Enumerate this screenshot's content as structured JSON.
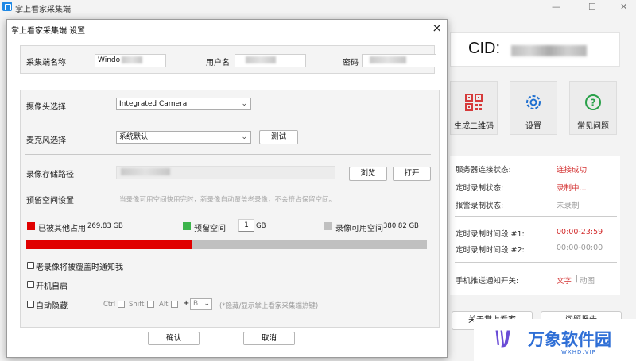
{
  "main": {
    "title": "掌上看家采集端",
    "cid_label": "CID:",
    "buttons": [
      {
        "label": "生成二维码",
        "icon": "qr-code-icon"
      },
      {
        "label": "设置",
        "icon": "gear-icon"
      },
      {
        "label": "常见问题",
        "icon": "question-icon"
      }
    ],
    "status": {
      "server_label": "服务器连接状态:",
      "server_value": "连接成功",
      "timer_rec_label": "定时录制状态:",
      "timer_rec_value": "录制中...",
      "alarm_rec_label": "报警录制状态:",
      "alarm_rec_value": "未录制",
      "interval1_label": "定时录制时间段 #1:",
      "interval1_value": "00:00-23:59",
      "interval2_label": "定时录制时间段 #2:",
      "interval2_value": "00:00-00:00",
      "push_label": "手机推送通知开关:",
      "push_text": "文字",
      "push_sep": "|",
      "push_anim": "动图"
    },
    "bottom_buttons": [
      "关于掌上看家",
      "问题报告"
    ]
  },
  "dialog": {
    "title": "掌上看家采集端 设置",
    "name_label": "采集端名称",
    "name_value": "Windo",
    "user_label": "用户名",
    "pwd_label": "密码",
    "camera_label": "摄像头选择",
    "camera_value": "Integrated Camera",
    "mic_label": "麦克风选择",
    "mic_value": "系统默认",
    "test_btn": "测试",
    "path_label": "录像存储路径",
    "browse_btn": "浏览",
    "open_btn": "打开",
    "reserve_label": "预留空间设置",
    "reserve_hint": "当录像可用空间快用完时，新录像自动覆盖老录像，不会挤占保留空间。",
    "used_label": "已被其他占用",
    "used_value": "269.83 GB",
    "reserved_label": "预留空间",
    "reserved_value": "1",
    "reserved_unit": "GB",
    "available_label": "录像可用空间",
    "available_value": "380.82 GB",
    "used_fraction": 0.415,
    "notify_label": "老录像将被覆盖时通知我",
    "autostart_label": "开机自启",
    "autohide_label": "自动隐藏",
    "key_ctrl": "Ctrl",
    "key_shift": "Shift",
    "key_alt": "Alt",
    "key_plus": "+",
    "key_letter": "B",
    "hotkey_hint": "(*隐藏/显示掌上看家采集端热键)",
    "ok_btn": "确认",
    "cancel_btn": "取消"
  },
  "watermark": {
    "logo": "\\\\J",
    "text": "万象软件园",
    "sub": "WXHD.VIP"
  },
  "colors": {
    "used": "#e00000",
    "reserved": "#3cb44b",
    "available": "#c0c0c0",
    "status_red": "#d32f2f"
  }
}
